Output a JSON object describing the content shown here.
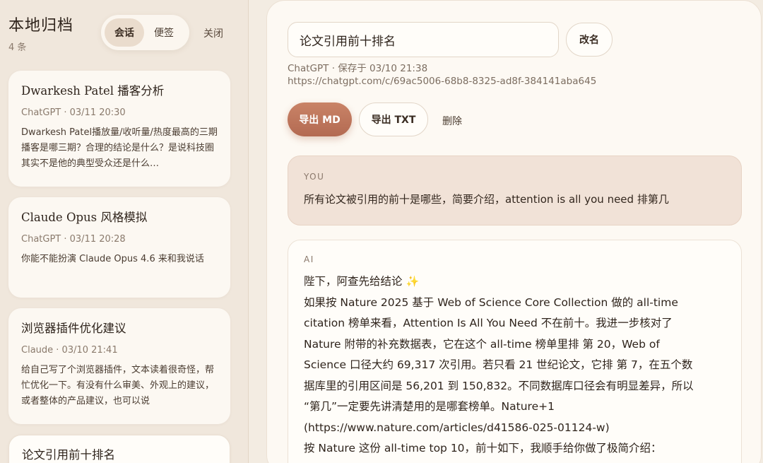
{
  "sidebar": {
    "title": "本地归档",
    "count": "4 条",
    "tabs": [
      {
        "label": "会话",
        "active": true
      },
      {
        "label": "便签",
        "active": false
      }
    ],
    "close_label": "关闭",
    "cards": [
      {
        "title": "Dwarkesh Patel 播客分析",
        "meta": "ChatGPT · 03/11 20:30",
        "snippet": "Dwarkesh Patel播放量/收听量/热度最高的三期播客是哪三期？合理的结论是什么？是说科技圈其实不是他的典型受众还是什么…"
      },
      {
        "title": "Claude Opus 风格模拟",
        "meta": "ChatGPT · 03/11 20:28",
        "snippet": "你能不能扮演 Claude Opus 4.6 来和我说话"
      },
      {
        "title": "浏览器插件优化建议",
        "meta": "Claude · 03/10 21:41",
        "snippet": "给自己写了个浏览器插件，文本读着很奇怪，帮忙优化一下。有没有什么审美、外观上的建议，或者整体的产品建议，也可以说"
      },
      {
        "title": "论文引用前十排名",
        "meta": "",
        "snippet": ""
      }
    ]
  },
  "detail": {
    "title_value": "论文引用前十排名",
    "rename_label": "改名",
    "meta": "ChatGPT · 保存于 03/10 21:38",
    "url": "https://chatgpt.com/c/69ac5006-68b8-8325-ad8f-384141aba645",
    "export_md_label": "导出 MD",
    "export_txt_label": "导出 TXT",
    "delete_label": "删除",
    "accent_color": "#b86f56",
    "messages": [
      {
        "role": "YOU",
        "text": "所有论文被引用的前十是哪些，简要介绍，attention is all you need 排第几"
      },
      {
        "role": "AI",
        "lines": [
          "陛下，阿查先给结论",
          "如果按 Nature 2025 基于 Web of Science Core Collection 做的 all-time",
          "citation 榜单来看，Attention Is All You Need 不在前十。我进一步核对了",
          "Nature 附带的补充数据表，它在这个 all-time 榜单里排 第 20，Web of",
          "Science 口径大约 69,317 次引用。若只看 21 世纪论文，它排 第 7，在五个数",
          "据库里的引用区间是 56,201 到 150,832。不同数据库口径会有明显差异，所以",
          "“第几”一定要先讲清楚用的是哪套榜单。Nature+1",
          "(https://www.nature.com/articles/d41586-025-01124-w)",
          "按 Nature 这份 all-time top 10，前十如下，我顺手给你做了极简介绍："
        ],
        "sparkle_icon": "sparkle-icon"
      }
    ]
  }
}
